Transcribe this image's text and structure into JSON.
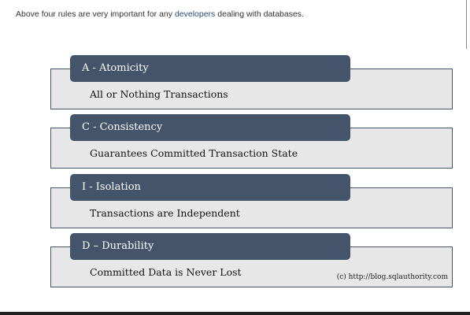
{
  "intro": {
    "before": "Above four rules are very important for any ",
    "link": "developers",
    "after": " dealing with databases."
  },
  "rules": [
    {
      "title": "A - Atomicity",
      "description": "All or Nothing Transactions"
    },
    {
      "title": "C - Consistency",
      "description": "Guarantees Committed Transaction State"
    },
    {
      "title": "I - Isolation",
      "description": "Transactions are Independent"
    },
    {
      "title": "D – Durability",
      "description": "Committed Data is Never Lost"
    }
  ],
  "credit": "(c) http://blog.sqlauthority.com",
  "colors": {
    "header": "#44546a",
    "box": "#e7e7e7"
  }
}
